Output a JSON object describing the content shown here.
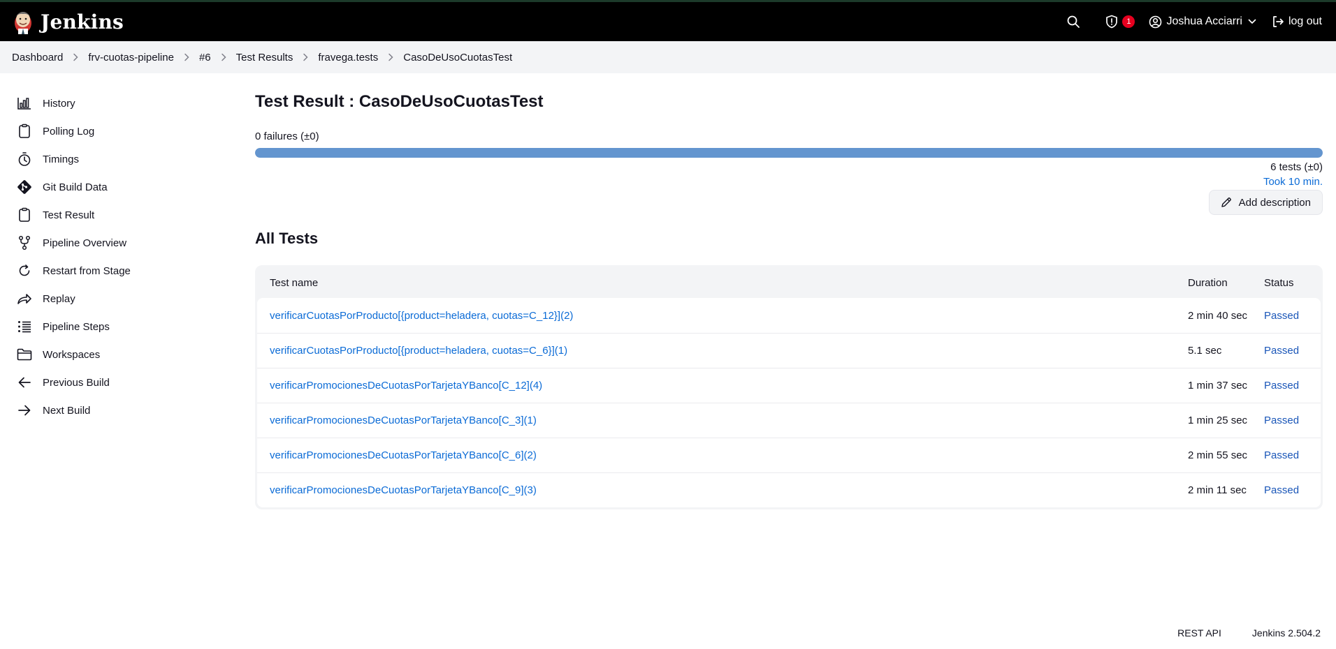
{
  "header": {
    "brand": "Jenkins",
    "security_badge_count": "1",
    "user_name": "Joshua Acciarri",
    "logout_label": "log out"
  },
  "breadcrumb": [
    "Dashboard",
    "frv-cuotas-pipeline",
    "#6",
    "Test Results",
    "fravega.tests",
    "CasoDeUsoCuotasTest"
  ],
  "sidebar": {
    "items": [
      {
        "label": "History",
        "icon": "history-icon"
      },
      {
        "label": "Polling Log",
        "icon": "clipboard-icon"
      },
      {
        "label": "Timings",
        "icon": "stopwatch-icon"
      },
      {
        "label": "Git Build Data",
        "icon": "git-icon"
      },
      {
        "label": "Test Result",
        "icon": "clipboard-icon"
      },
      {
        "label": "Pipeline Overview",
        "icon": "branch-icon"
      },
      {
        "label": "Restart from Stage",
        "icon": "restart-icon"
      },
      {
        "label": "Replay",
        "icon": "replay-arrow-icon"
      },
      {
        "label": "Pipeline Steps",
        "icon": "steps-list-icon"
      },
      {
        "label": "Workspaces",
        "icon": "folder-icon"
      },
      {
        "label": "Previous Build",
        "icon": "arrow-left-icon"
      },
      {
        "label": "Next Build",
        "icon": "arrow-right-icon"
      }
    ]
  },
  "main": {
    "title": "Test Result : CasoDeUsoCuotasTest",
    "failures": "0 failures (±0)",
    "pass_fraction": 1.0,
    "tests_count": "6 tests (±0)",
    "took": "Took 10 min.",
    "add_description": "Add description",
    "all_tests_title": "All Tests",
    "table": {
      "headers": {
        "name": "Test name",
        "duration": "Duration",
        "status": "Status"
      },
      "rows": [
        {
          "name": "verificarCuotasPorProducto[{product=heladera, cuotas=C_12}](2)",
          "duration": "2 min 40 sec",
          "status": "Passed"
        },
        {
          "name": "verificarCuotasPorProducto[{product=heladera, cuotas=C_6}](1)",
          "duration": "5.1 sec",
          "status": "Passed"
        },
        {
          "name": "verificarPromocionesDeCuotasPorTarjetaYBanco[C_12](4)",
          "duration": "1 min 37 sec",
          "status": "Passed"
        },
        {
          "name": "verificarPromocionesDeCuotasPorTarjetaYBanco[C_3](1)",
          "duration": "1 min 25 sec",
          "status": "Passed"
        },
        {
          "name": "verificarPromocionesDeCuotasPorTarjetaYBanco[C_6](2)",
          "duration": "2 min 55 sec",
          "status": "Passed"
        },
        {
          "name": "verificarPromocionesDeCuotasPorTarjetaYBanco[C_9](3)",
          "duration": "2 min 11 sec",
          "status": "Passed"
        }
      ]
    }
  },
  "footer": {
    "rest_api": "REST API",
    "version": "Jenkins 2.504.2"
  },
  "colors": {
    "header_bg": "#000000",
    "link": "#0b6bd6",
    "progress_pass": "#6395cf",
    "badge": "#e6001f"
  }
}
